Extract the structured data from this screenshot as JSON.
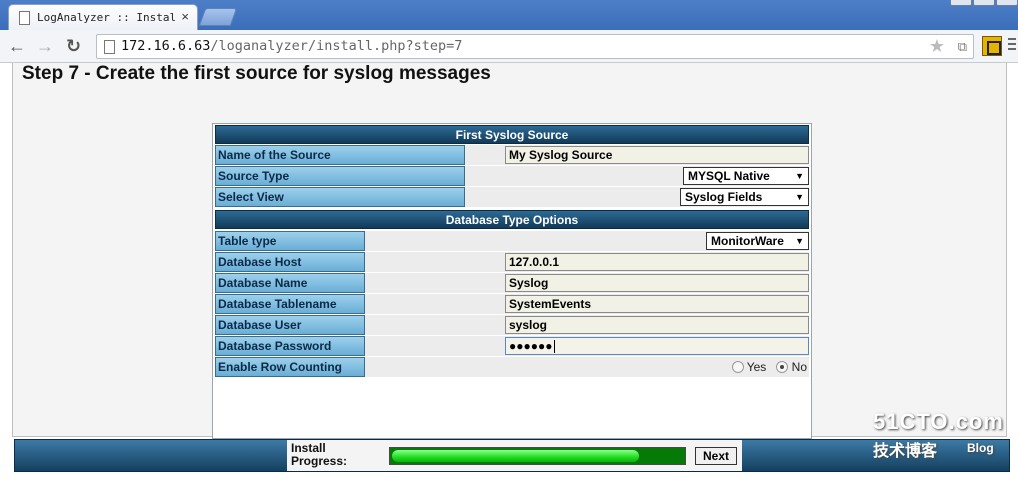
{
  "browser": {
    "tab_title": "LogAnalyzer :: Installe",
    "tab_close": "×",
    "back_glyph": "←",
    "forward_glyph": "→",
    "reload_glyph": "↻",
    "url_host": "172.16.6.63",
    "url_path": "/loganalyzer/install.php?step=7",
    "star_glyph": "★",
    "pageaction_glyph": "⧉",
    "icons": [
      "page-icon",
      "close-icon",
      "back-arrow-icon",
      "forward-arrow-icon",
      "reload-icon",
      "bookmark-star-icon",
      "extension-icon",
      "menu-icon"
    ]
  },
  "page": {
    "step_title": "Step 7 - Create the first source for syslog messages"
  },
  "form": {
    "section1_title": "First Syslog Source",
    "section2_title": "Database Type Options",
    "source_name": {
      "label": "Name of the Source",
      "value": "My Syslog Source"
    },
    "source_type": {
      "label": "Source Type",
      "value": "MYSQL Native"
    },
    "select_view": {
      "label": "Select View",
      "value": "Syslog Fields"
    },
    "table_type": {
      "label": "Table type",
      "value": "MonitorWare"
    },
    "db_host": {
      "label": "Database Host",
      "value": "127.0.0.1"
    },
    "db_name": {
      "label": "Database Name",
      "value": "Syslog"
    },
    "db_table": {
      "label": "Database Tablename",
      "value": "SystemEvents"
    },
    "db_user": {
      "label": "Database User",
      "value": "syslog"
    },
    "db_password": {
      "label": "Database Password",
      "value": "●●●●●●"
    },
    "row_counting": {
      "label": "Enable Row Counting",
      "yes_label": "Yes",
      "no_label": "No",
      "selected": "No"
    },
    "dropdown_glyph": "▼"
  },
  "footer": {
    "progress_label_1": "Install",
    "progress_label_2": "Progress:",
    "progress_fraction": 0.85,
    "next_label": "Next"
  },
  "watermark": {
    "line1": "51CTO.com",
    "line2": "技术博客",
    "blog": "Blog"
  }
}
